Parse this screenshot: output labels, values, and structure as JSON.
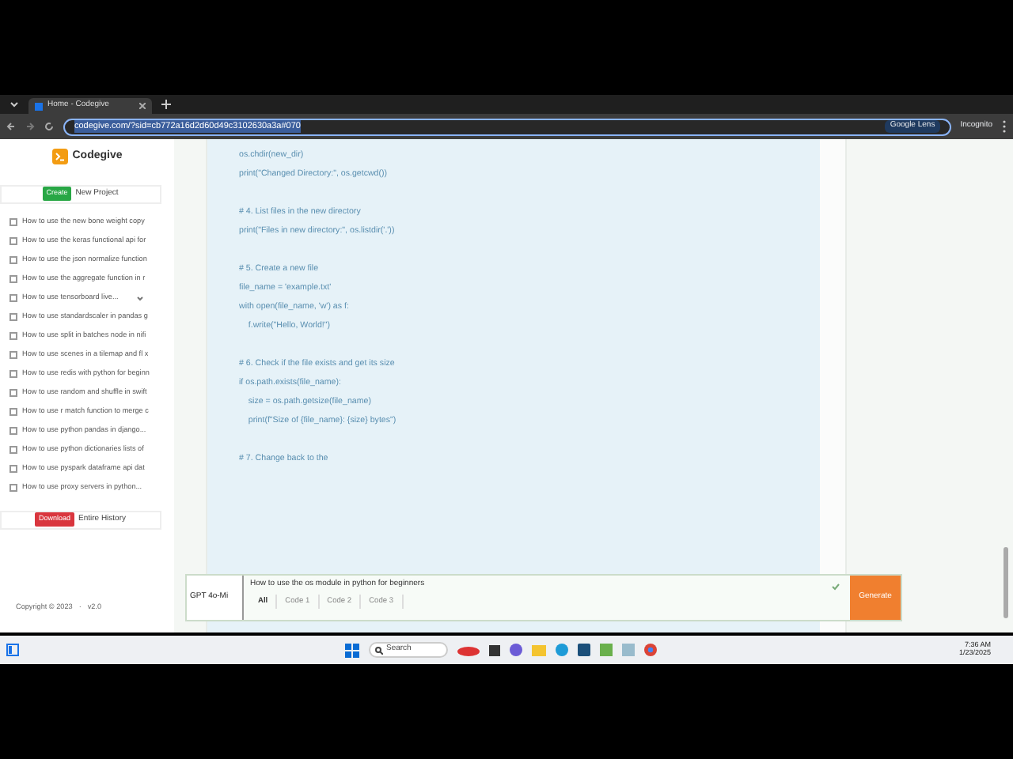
{
  "browser": {
    "tab_title": "Home - Codegive",
    "url": "codegive.com/?sid=cb772a16d2d60d49c3102630a3a#070",
    "lens": "Google Lens",
    "incognito": "Incognito"
  },
  "sidebar": {
    "logo": "Codegive",
    "create_badge": "Create",
    "create_label": "New Project",
    "history": [
      {
        "title": "How to use the new bone weight copy",
        "has_menu": false
      },
      {
        "title": "How to use the keras functional api for",
        "has_menu": false
      },
      {
        "title": "How to use the json normalize function",
        "has_menu": false
      },
      {
        "title": "How to use the aggregate function in r",
        "has_menu": false
      },
      {
        "title": "How to use tensorboard live...",
        "has_menu": true
      },
      {
        "title": "How to use standardscaler in pandas g",
        "has_menu": false
      },
      {
        "title": "How to use split in batches node in nifi",
        "has_menu": false
      },
      {
        "title": "How to use scenes in a tilemap and fl x",
        "has_menu": false
      },
      {
        "title": "How to use redis with python for beginn",
        "has_menu": false
      },
      {
        "title": "How to use random and shuffle in swift",
        "has_menu": false
      },
      {
        "title": "How to use r match function to merge c",
        "has_menu": false
      },
      {
        "title": "How to use python pandas in django...",
        "has_menu": false
      },
      {
        "title": "How to use python dictionaries lists of",
        "has_menu": false
      },
      {
        "title": "How to use pyspark dataframe api dat",
        "has_menu": false
      },
      {
        "title": "How to use proxy servers in python...",
        "has_menu": false
      }
    ],
    "download_badge": "Download",
    "download_label": "Entire History",
    "copyright": "Copyright © 2023",
    "separator": "·",
    "version": "v2.0"
  },
  "code_blocks": [
    [
      "os.chdir(new_dir)",
      "print(\"Changed Directory:\", os.getcwd())"
    ],
    [
      "# 4. List files in the new directory",
      "print(\"Files in new directory:\", os.listdir('.'))"
    ],
    [
      "# 5. Create a new file",
      "file_name = 'example.txt'",
      "with open(file_name, 'w') as f:",
      "    f.write(\"Hello, World!\")"
    ],
    [
      "# 6. Check if the file exists and get its size",
      "if os.path.exists(file_name):",
      "    size = os.path.getsize(file_name)",
      "    print(f\"Size of {file_name}: {size} bytes\")"
    ],
    [
      "# 7. Change back to the"
    ]
  ],
  "prompt": {
    "model": "GPT 4o-Mi",
    "text": "How to use the os module in python for beginners",
    "filters": [
      {
        "label": "All",
        "selected": true
      },
      {
        "label": "Code 1",
        "selected": false
      },
      {
        "label": "Code 2",
        "selected": false
      },
      {
        "label": "Code 3",
        "selected": false
      }
    ],
    "generate": "Generate"
  },
  "taskbar": {
    "search": "Search",
    "time": "7:36 AM",
    "date": "1/23/2025"
  }
}
